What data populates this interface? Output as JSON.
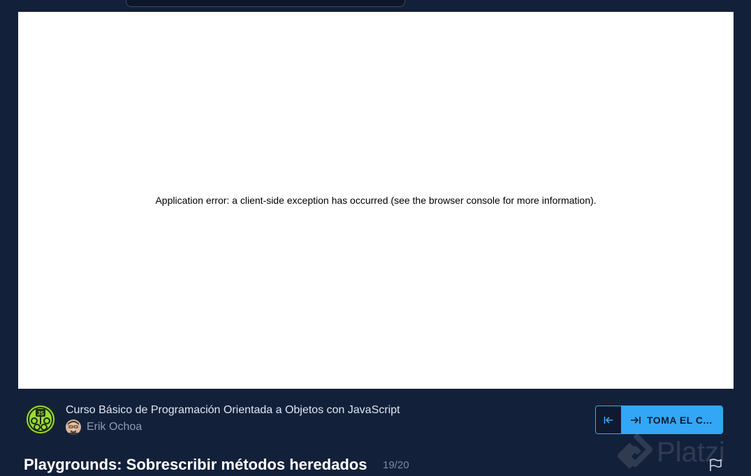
{
  "player": {
    "error_message": "Application error: a client-side exception has occurred (see the browser console for more information)."
  },
  "course": {
    "badge_label": "JS",
    "title": "Curso Básico de Programación Orientada a Objetos con JavaScript",
    "teacher": "Erik Ochoa"
  },
  "navigation": {
    "next_label": "TOMA EL C..."
  },
  "class": {
    "title": "Playgrounds: Sobrescribir métodos heredados",
    "counter": "19/20"
  },
  "watermark": {
    "text": "Platzi"
  },
  "colors": {
    "background": "#13203a",
    "accent": "#33a7f5",
    "badge_green": "#9ad93a"
  }
}
